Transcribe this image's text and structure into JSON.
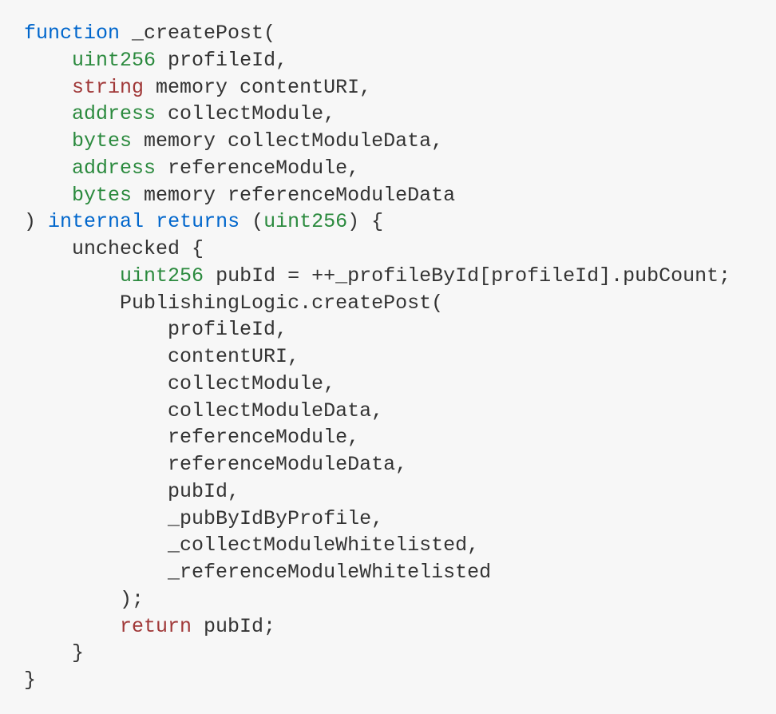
{
  "code": {
    "lines": [
      {
        "indent": 0,
        "tokens": [
          [
            "kw-func",
            "function"
          ],
          [
            "plain",
            " _createPost("
          ]
        ]
      },
      {
        "indent": 1,
        "tokens": [
          [
            "kw-uint",
            "uint256"
          ],
          [
            "plain",
            " profileId,"
          ]
        ]
      },
      {
        "indent": 1,
        "tokens": [
          [
            "kw-string",
            "string"
          ],
          [
            "plain",
            " memory contentURI,"
          ]
        ]
      },
      {
        "indent": 1,
        "tokens": [
          [
            "kw-address",
            "address"
          ],
          [
            "plain",
            " collectModule,"
          ]
        ]
      },
      {
        "indent": 1,
        "tokens": [
          [
            "kw-bytes",
            "bytes"
          ],
          [
            "plain",
            " memory collectModuleData,"
          ]
        ]
      },
      {
        "indent": 1,
        "tokens": [
          [
            "kw-address",
            "address"
          ],
          [
            "plain",
            " referenceModule,"
          ]
        ]
      },
      {
        "indent": 1,
        "tokens": [
          [
            "kw-bytes",
            "bytes"
          ],
          [
            "plain",
            " memory referenceModuleData"
          ]
        ]
      },
      {
        "indent": 0,
        "tokens": [
          [
            "plain",
            ") "
          ],
          [
            "kw-internal",
            "internal"
          ],
          [
            "plain",
            " "
          ],
          [
            "kw-returns",
            "returns"
          ],
          [
            "plain",
            " ("
          ],
          [
            "kw-uint",
            "uint256"
          ],
          [
            "plain",
            ") {"
          ]
        ]
      },
      {
        "indent": 1,
        "tokens": [
          [
            "kw-unchecked",
            "unchecked"
          ],
          [
            "plain",
            " {"
          ]
        ]
      },
      {
        "indent": 2,
        "tokens": [
          [
            "kw-uint",
            "uint256"
          ],
          [
            "plain",
            " pubId = ++_profileById[profileId].pubCount;"
          ]
        ]
      },
      {
        "indent": 2,
        "tokens": [
          [
            "plain",
            "PublishingLogic.createPost("
          ]
        ]
      },
      {
        "indent": 3,
        "tokens": [
          [
            "plain",
            "profileId,"
          ]
        ]
      },
      {
        "indent": 3,
        "tokens": [
          [
            "plain",
            "contentURI,"
          ]
        ]
      },
      {
        "indent": 3,
        "tokens": [
          [
            "plain",
            "collectModule,"
          ]
        ]
      },
      {
        "indent": 3,
        "tokens": [
          [
            "plain",
            "collectModuleData,"
          ]
        ]
      },
      {
        "indent": 3,
        "tokens": [
          [
            "plain",
            "referenceModule,"
          ]
        ]
      },
      {
        "indent": 3,
        "tokens": [
          [
            "plain",
            "referenceModuleData,"
          ]
        ]
      },
      {
        "indent": 3,
        "tokens": [
          [
            "plain",
            "pubId,"
          ]
        ]
      },
      {
        "indent": 3,
        "tokens": [
          [
            "plain",
            "_pubByIdByProfile,"
          ]
        ]
      },
      {
        "indent": 3,
        "tokens": [
          [
            "plain",
            "_collectModuleWhitelisted,"
          ]
        ]
      },
      {
        "indent": 3,
        "tokens": [
          [
            "plain",
            "_referenceModuleWhitelisted"
          ]
        ]
      },
      {
        "indent": 2,
        "tokens": [
          [
            "plain",
            ");"
          ]
        ]
      },
      {
        "indent": 2,
        "tokens": [
          [
            "kw-return",
            "return"
          ],
          [
            "plain",
            " pubId;"
          ]
        ]
      },
      {
        "indent": 1,
        "tokens": [
          [
            "plain",
            "}"
          ]
        ]
      },
      {
        "indent": 0,
        "tokens": [
          [
            "plain",
            "}"
          ]
        ]
      }
    ],
    "indentSpaces": 4
  }
}
